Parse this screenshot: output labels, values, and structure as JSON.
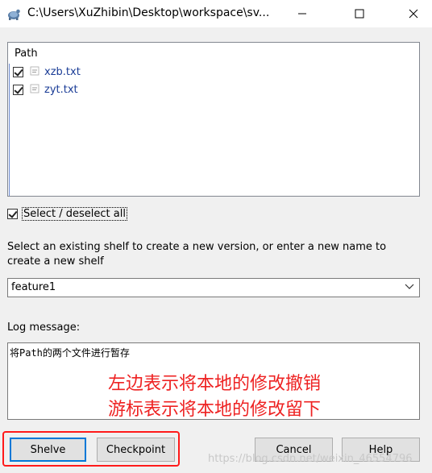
{
  "window": {
    "title": "C:\\Users\\XuZhibin\\Desktop\\workspace\\sv...",
    "controls": {
      "minimize": "—",
      "maximize": "☐",
      "close": "✕"
    }
  },
  "file_list": {
    "column_header": "Path",
    "files": [
      {
        "name": "xzb.txt",
        "checked": true
      },
      {
        "name": "zyt.txt",
        "checked": true
      }
    ]
  },
  "select_all": {
    "label": "Select / deselect all",
    "checked": true
  },
  "shelf": {
    "instructions": "Select an existing shelf to create a new version, or enter a new name to create a new shelf",
    "selected": "feature1"
  },
  "log": {
    "label": "Log message:",
    "text": "将Path的两个文件进行暂存"
  },
  "annotations": {
    "line1": "左边表示将本地的修改撤销",
    "line2": "游标表示将本地的修改留下",
    "color": "#ee2222"
  },
  "buttons": {
    "shelve": "Shelve",
    "checkpoint": "Checkpoint",
    "cancel": "Cancel",
    "help": "Help"
  },
  "watermark": "https://blog.csdn.net/weixin_46554796"
}
